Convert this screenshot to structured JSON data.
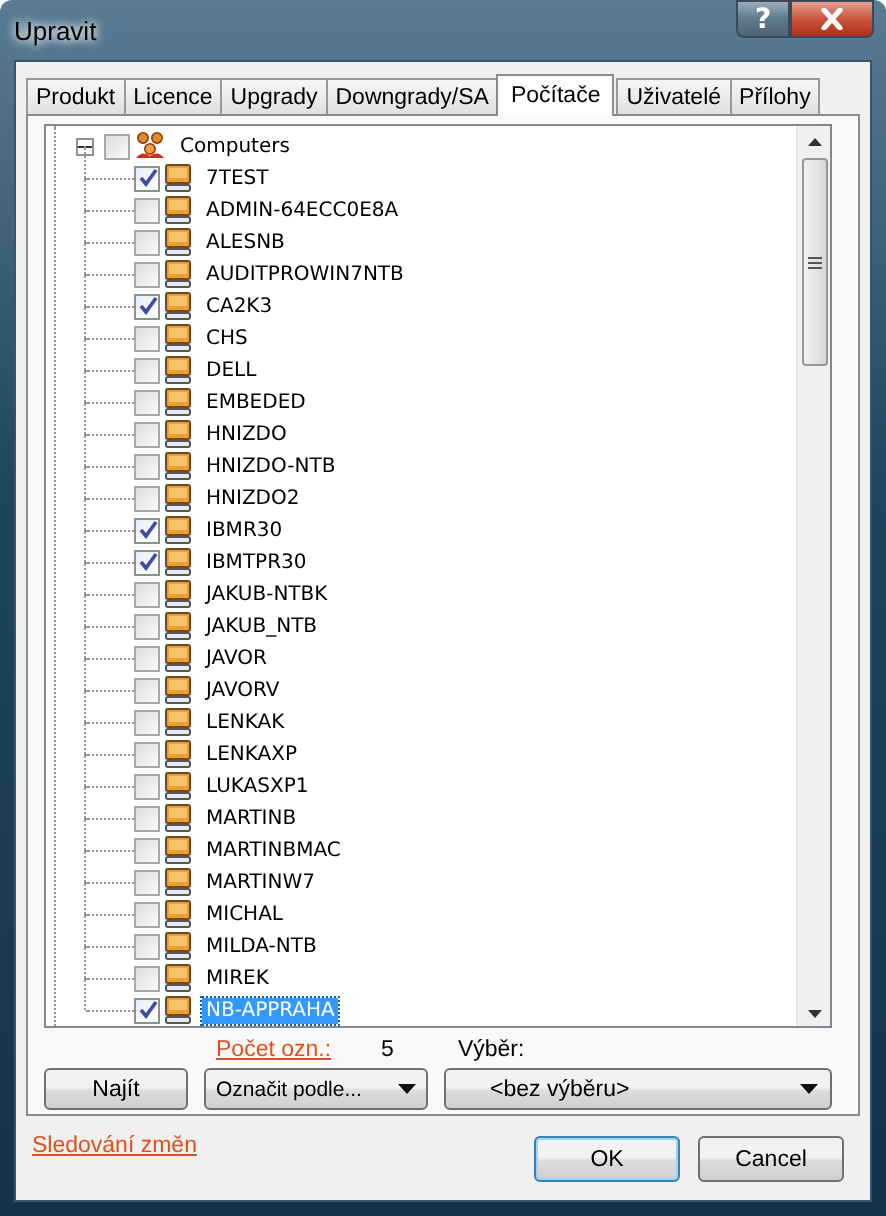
{
  "window": {
    "title": "Upravit",
    "help": "?"
  },
  "tabs": [
    {
      "label": "Produkt",
      "selected": false
    },
    {
      "label": "Licence",
      "selected": false
    },
    {
      "label": "Upgrady",
      "selected": false
    },
    {
      "label": "Downgrady/SA",
      "selected": false
    },
    {
      "label": "Počítače",
      "selected": true
    },
    {
      "label": "Uživatelé",
      "selected": false
    },
    {
      "label": "Přílohy",
      "selected": false
    }
  ],
  "tree": {
    "label": "Computers",
    "expanded": true,
    "checked": false,
    "children": [
      {
        "label": "7TEST",
        "checked": true,
        "selected": false
      },
      {
        "label": "ADMIN-64ECC0E8A",
        "checked": false,
        "selected": false
      },
      {
        "label": "ALESNB",
        "checked": false,
        "selected": false
      },
      {
        "label": "AUDITPROWIN7NTB",
        "checked": false,
        "selected": false
      },
      {
        "label": "CA2K3",
        "checked": true,
        "selected": false
      },
      {
        "label": "CHS",
        "checked": false,
        "selected": false
      },
      {
        "label": "DELL",
        "checked": false,
        "selected": false
      },
      {
        "label": "EMBEDED",
        "checked": false,
        "selected": false
      },
      {
        "label": "HNIZDO",
        "checked": false,
        "selected": false
      },
      {
        "label": "HNIZDO-NTB",
        "checked": false,
        "selected": false
      },
      {
        "label": "HNIZDO2",
        "checked": false,
        "selected": false
      },
      {
        "label": "IBMR30",
        "checked": true,
        "selected": false
      },
      {
        "label": "IBMTPR30",
        "checked": true,
        "selected": false
      },
      {
        "label": "JAKUB-NTBK",
        "checked": false,
        "selected": false
      },
      {
        "label": "JAKUB_NTB",
        "checked": false,
        "selected": false
      },
      {
        "label": "JAVOR",
        "checked": false,
        "selected": false
      },
      {
        "label": "JAVORV",
        "checked": false,
        "selected": false
      },
      {
        "label": "LENKAK",
        "checked": false,
        "selected": false
      },
      {
        "label": "LENKAXP",
        "checked": false,
        "selected": false
      },
      {
        "label": "LUKASXP1",
        "checked": false,
        "selected": false
      },
      {
        "label": "MARTINB",
        "checked": false,
        "selected": false
      },
      {
        "label": "MARTINBMAC",
        "checked": false,
        "selected": false
      },
      {
        "label": "MARTINW7",
        "checked": false,
        "selected": false
      },
      {
        "label": "MICHAL",
        "checked": false,
        "selected": false
      },
      {
        "label": "MILDA-NTB",
        "checked": false,
        "selected": false
      },
      {
        "label": "MIREK",
        "checked": false,
        "selected": false
      },
      {
        "label": "NB-APPRAHA",
        "checked": true,
        "selected": true
      }
    ]
  },
  "count": {
    "label": "Počet ozn.:",
    "value": "5"
  },
  "selection": {
    "label": "Výběr:",
    "value": "<bez výběru>"
  },
  "buttons": {
    "find": "Najít",
    "mark_by": "Označit podle..."
  },
  "history_link": "Sledování změn",
  "dialog_buttons": [
    {
      "label": "OK",
      "kind": "default"
    },
    {
      "label": "Cancel",
      "kind": "normal"
    }
  ]
}
